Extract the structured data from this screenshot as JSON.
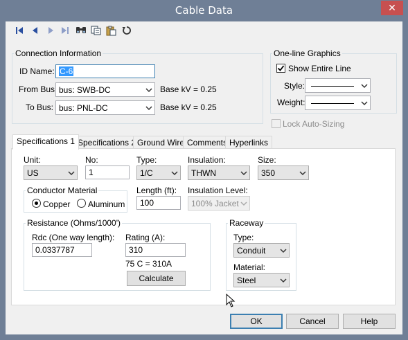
{
  "window": {
    "title": "Cable Data",
    "close_symbol": "✕"
  },
  "toolbar": {
    "icons": [
      "first-record-icon",
      "previous-record-icon",
      "next-record-icon",
      "last-record-icon",
      "find-icon",
      "copy-icon",
      "paste-icon",
      "undo-icon"
    ]
  },
  "connection": {
    "legend": "Connection Information",
    "id_label": "ID Name:",
    "id_value": "C-6",
    "from_label": "From Bus:",
    "from_value": "bus: SWB-DC",
    "from_basekv": "Base kV = 0.25",
    "to_label": "To Bus:",
    "to_value": "bus: PNL-DC",
    "to_basekv": "Base kV = 0.25"
  },
  "oneline": {
    "legend": "One-line Graphics",
    "show_entire_line_label": "Show Entire Line",
    "show_entire_line_checked": true,
    "style_label": "Style:",
    "weight_label": "Weight:"
  },
  "lock_autosizing": {
    "label": "Lock Auto-Sizing",
    "checked": false
  },
  "tabs": [
    "Specifications 1",
    "Specifications 2",
    "Ground Wire",
    "Comments",
    "Hyperlinks"
  ],
  "specs": {
    "unit_label": "Unit:",
    "unit_value": "US",
    "no_label": "No:",
    "no_value": "1",
    "type_label": "Type:",
    "type_value": "1/C",
    "insulation_label": "Insulation:",
    "insulation_value": "THWN",
    "size_label": "Size:",
    "size_value": "350",
    "conductor_legend": "Conductor Material",
    "copper_label": "Copper",
    "aluminum_label": "Aluminum",
    "conductor_selected": "Copper",
    "length_label": "Length (ft):",
    "length_value": "100",
    "insulation_level_label": "Insulation Level:",
    "insulation_level_value": "100% Jacket",
    "resistance_legend": "Resistance (Ohms/1000')",
    "rdc_label": "Rdc (One way length):",
    "rdc_value": "0.0337787",
    "rating_label": "Rating (A):",
    "rating_value": "310",
    "rating_note": "75 C = 310A",
    "calculate_label": "Calculate",
    "raceway_legend": "Raceway",
    "raceway_type_label": "Type:",
    "raceway_type_value": "Conduit",
    "material_label": "Material:",
    "material_value": "Steel"
  },
  "buttons": {
    "ok": "OK",
    "cancel": "Cancel",
    "help": "Help"
  },
  "colors": {
    "titlebar": "#6f7f96",
    "close": "#c75050",
    "selection": "#3399ff",
    "default_button_border": "#3c7fb1"
  }
}
